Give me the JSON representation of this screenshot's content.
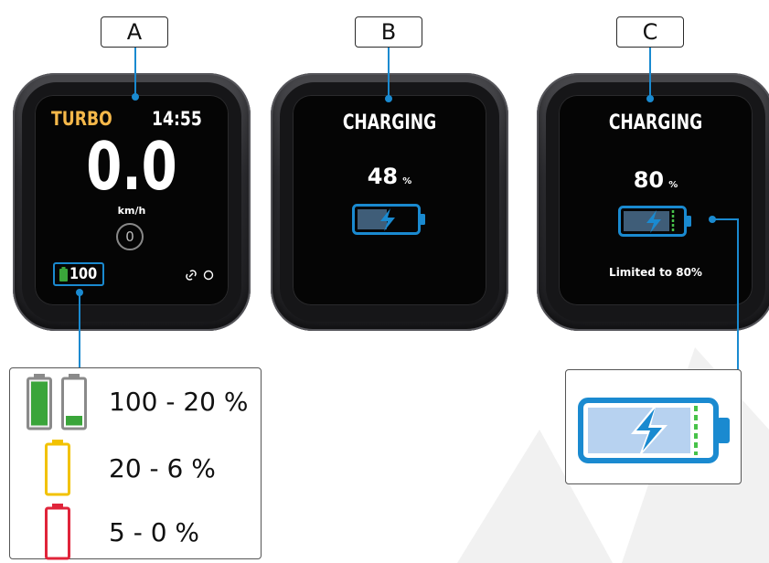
{
  "callouts": {
    "a": "A",
    "b": "B",
    "c": "C"
  },
  "screen_a": {
    "mode": "TURBO",
    "time": "14:55",
    "speed": "0.0",
    "unit": "km/h",
    "gear": "0",
    "battery_level": "100"
  },
  "screen_b": {
    "status": "CHARGING",
    "percent_value": "48",
    "percent_sign": "%"
  },
  "screen_c": {
    "status": "CHARGING",
    "percent_value": "80",
    "percent_sign": "%",
    "note": "Limited to 80%"
  },
  "legend": {
    "ranges": [
      {
        "label": "100 - 20 %",
        "color": "#3aa53a"
      },
      {
        "label": "20 - 6 %",
        "color": "#f2c200"
      },
      {
        "label": "5 - 0 %",
        "color": "#e0243a"
      }
    ]
  },
  "colors": {
    "accent_blue": "#1a8ad0",
    "turbo_orange": "#f5b84a",
    "battery_green": "#3aa53a",
    "battery_yellow": "#f2c200",
    "battery_red": "#e0243a",
    "limit_green": "#47c24a",
    "battery_fill_light": "#b7d2f0"
  }
}
